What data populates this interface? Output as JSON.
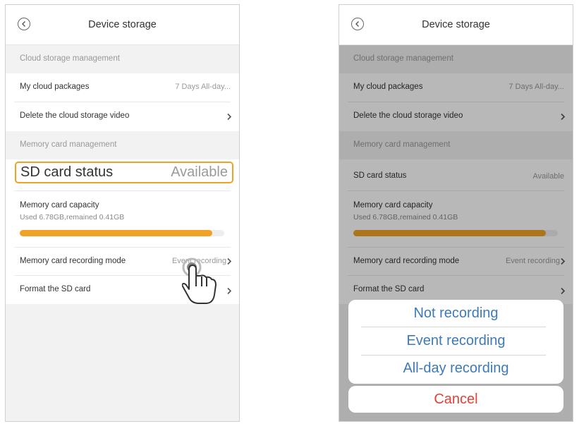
{
  "screen": {
    "title": "Device storage",
    "cloud_section": "Cloud storage management",
    "cloud_packages": {
      "label": "My cloud packages",
      "value": "7 Days All-day..."
    },
    "delete_cloud": {
      "label": "Delete the cloud storage video"
    },
    "memory_section": "Memory card management",
    "sd_status": {
      "label": "SD card status",
      "value": "Available"
    },
    "capacity": {
      "label": "Memory card capacity",
      "detail": "Used 6.78GB,remained 0.41GB",
      "used_fraction": 0.943
    },
    "recording_mode": {
      "label": "Memory card recording mode",
      "value": "Event recording"
    },
    "format": {
      "label": "Format the SD card"
    }
  },
  "action_sheet": {
    "options": [
      "Not recording",
      "Event recording",
      "All-day recording"
    ],
    "cancel": "Cancel"
  },
  "colors": {
    "accent": "#f0a226",
    "option_text": "#3d7ab8",
    "cancel_text": "#e04338",
    "overlay": "rgba(0,0,0,0.28)"
  },
  "icons": [
    "back-icon",
    "chevron-right-icon",
    "tap-hand-icon"
  ]
}
